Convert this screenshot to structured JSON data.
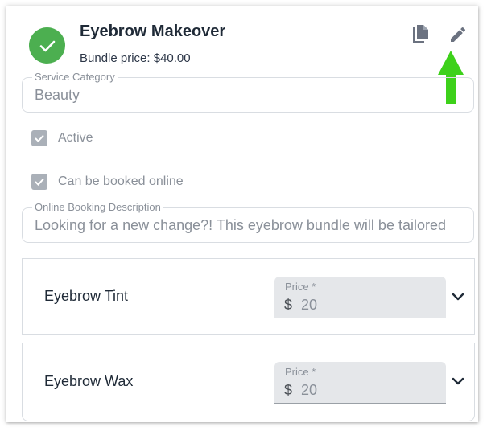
{
  "header": {
    "title": "Eyebrow Makeover",
    "subtitle": "Bundle price: $40.00",
    "status_icon": "check-circle-icon",
    "status_color": "#4caf50",
    "actions": [
      "copy-icon",
      "edit-icon"
    ],
    "annotation_color": "#3dd11a"
  },
  "service_category": {
    "label": "Service Category",
    "value": "Beauty"
  },
  "active": {
    "label": "Active",
    "checked": true
  },
  "online": {
    "label": "Can be booked online",
    "checked": true
  },
  "booking_description": {
    "label": "Online Booking Description",
    "value": "Looking for a new change?!  This eyebrow bundle will  be tailored"
  },
  "services": [
    {
      "name": "Eyebrow Tint",
      "price_label": "Price *",
      "currency": "$",
      "price": "20"
    },
    {
      "name": "Eyebrow Wax",
      "price_label": "Price *",
      "currency": "$",
      "price": "20"
    }
  ]
}
